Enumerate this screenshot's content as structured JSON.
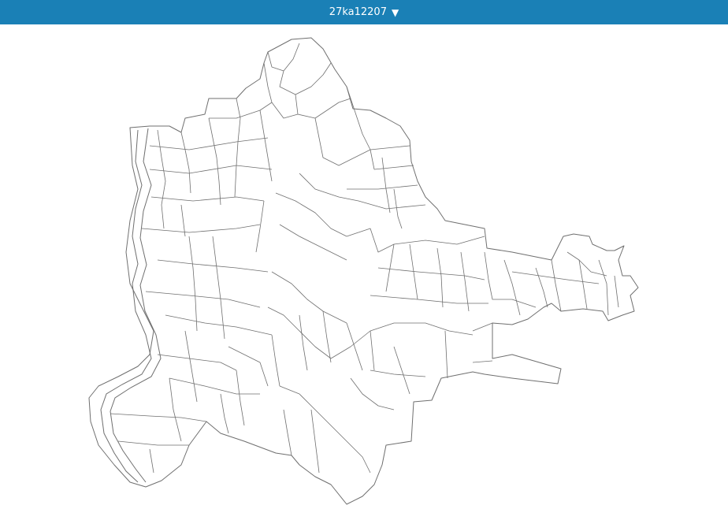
{
  "header": {
    "code": "27ka12207",
    "dropdown_icon": "triangle-down-icon"
  },
  "colors": {
    "header_bg": "#1a80b6",
    "header_text": "#ffffff",
    "boundary_stroke": "#6f6f6f",
    "map_fill": "#ffffff"
  }
}
